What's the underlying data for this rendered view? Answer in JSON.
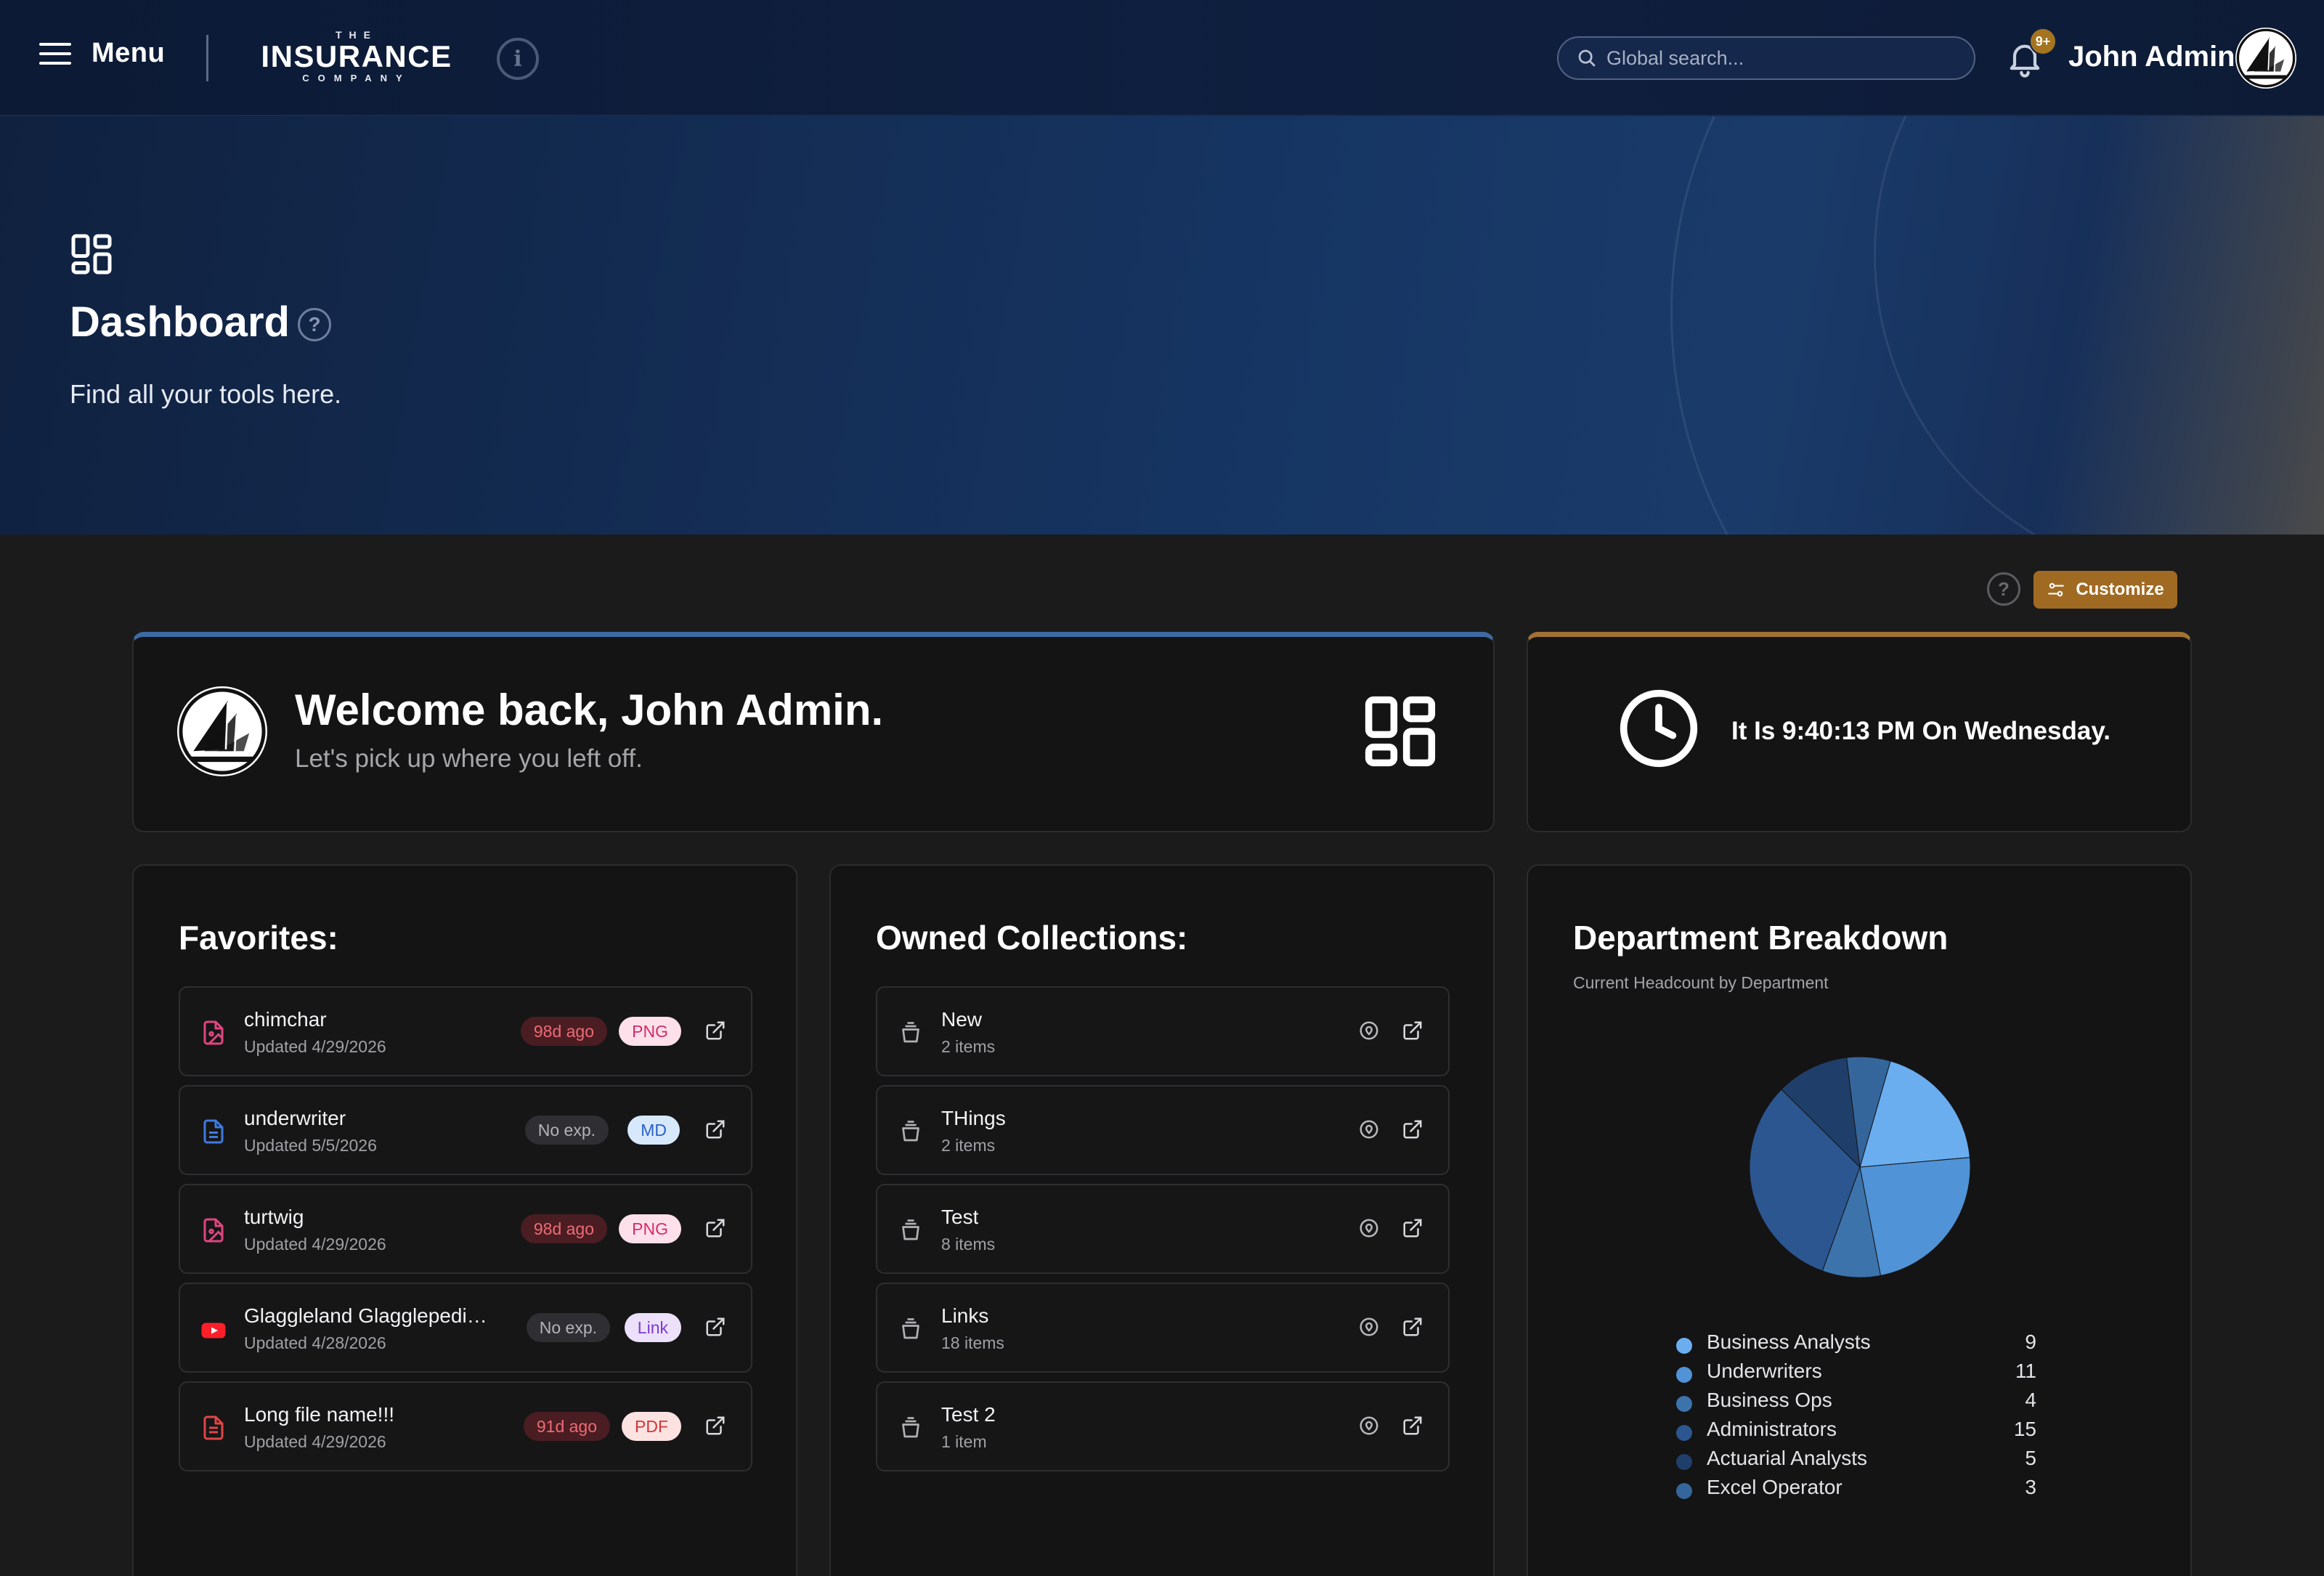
{
  "header": {
    "menu_label": "Menu",
    "logo_top": "THE",
    "logo_main": "INSURANCE",
    "logo_bottom": "COMPANY",
    "search_placeholder": "Global search...",
    "notification_badge": "9+",
    "user_name": "John Admin"
  },
  "hero": {
    "title": "Dashboard",
    "subtitle": "Find all your tools here."
  },
  "toolbar": {
    "customize_label": "Customize"
  },
  "welcome": {
    "title": "Welcome back, John Admin.",
    "subtitle": "Let's pick up where you left off."
  },
  "clock": {
    "text": "It Is 9:40:13 PM On Wednesday."
  },
  "favorites": {
    "title": "Favorites:",
    "items": [
      {
        "name": "chimchar",
        "meta": "Updated 4/29/2026",
        "expiry": "98d ago",
        "type": "PNG",
        "icon": "image-file-icon",
        "color": "#e0457f"
      },
      {
        "name": "underwriter",
        "meta": "Updated 5/5/2026",
        "expiry": "No exp.",
        "type": "MD",
        "icon": "document-file-icon",
        "color": "#3f7be0"
      },
      {
        "name": "turtwig",
        "meta": "Updated 4/29/2026",
        "expiry": "98d ago",
        "type": "PNG",
        "icon": "image-file-icon",
        "color": "#e0457f"
      },
      {
        "name": "Glaggleland Glagglepedia ...",
        "meta": "Updated 4/28/2026",
        "expiry": "No exp.",
        "type": "Link",
        "icon": "youtube-icon",
        "color": "#ff1f2a"
      },
      {
        "name": "Long file name!!!",
        "meta": "Updated 4/29/2026",
        "expiry": "91d ago",
        "type": "PDF",
        "icon": "pdf-file-icon",
        "color": "#e04545"
      }
    ]
  },
  "collections": {
    "title": "Owned Collections:",
    "items": [
      {
        "name": "New",
        "meta": "2 items"
      },
      {
        "name": "THings",
        "meta": "2 items"
      },
      {
        "name": "Test",
        "meta": "8 items"
      },
      {
        "name": "Links",
        "meta": "18 items"
      },
      {
        "name": "Test 2",
        "meta": "1 item"
      }
    ]
  },
  "department": {
    "title": "Department Breakdown",
    "subtitle": "Current Headcount by Department"
  },
  "chart_data": {
    "type": "pie",
    "categories": [
      "Business Analysts",
      "Underwriters",
      "Business Ops",
      "Administrators",
      "Actuarial Analysts",
      "Excel Operator"
    ],
    "values": [
      9,
      11,
      4,
      15,
      5,
      3
    ],
    "colors": [
      "#6aaef0",
      "#5093d6",
      "#3d73ab",
      "#2b568f",
      "#1f3f6a",
      "#35669b"
    ],
    "legend": "bottom"
  }
}
